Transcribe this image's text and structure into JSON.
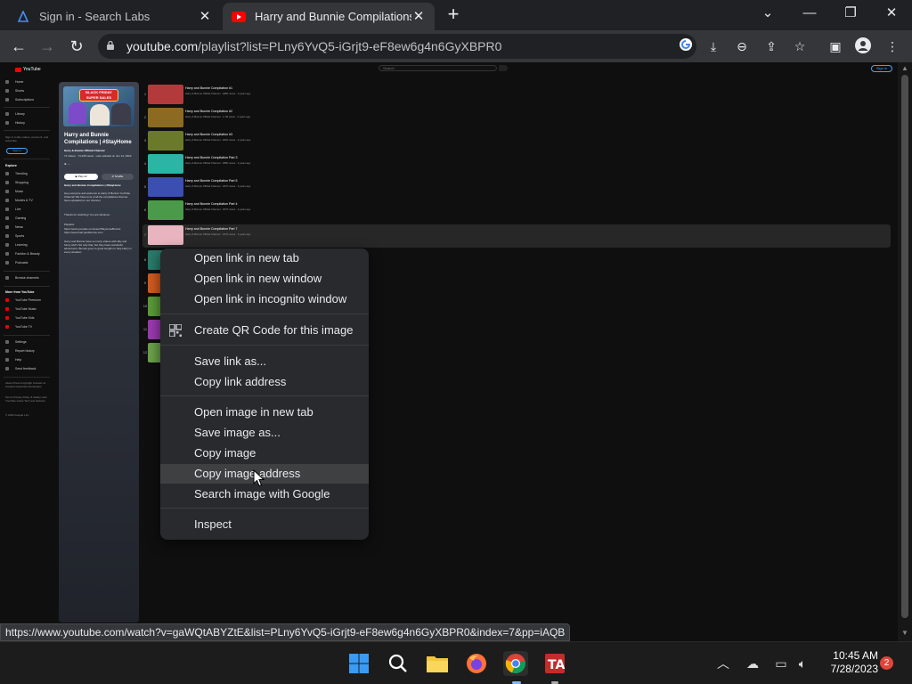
{
  "browser": {
    "tabs": [
      {
        "title": "Sign in - Search Labs",
        "icon": "search-labs-icon"
      },
      {
        "title": "Harry and Bunnie Compilations | ",
        "icon": "youtube-icon"
      }
    ],
    "url_host": "youtube.com",
    "url_path": "/playlist?list=PLny6YvQ5-iGrjt9-eF8ew6g4n6GyXBPR0",
    "status_url": "https://www.youtube.com/watch?v=gaWQtABYZtE&list=PLny6YvQ5-iGrjt9-eF8ew6g4n6GyXBPR0&index=7&pp=iAQB"
  },
  "youtube": {
    "logo": "YouTube",
    "search_placeholder": "Search",
    "sign_in": "Sign in",
    "guide": {
      "items_top": [
        "Home",
        "Shorts",
        "Subscriptions"
      ],
      "items_lib": [
        "Library",
        "History"
      ],
      "signin_prompt": "Sign in to like videos, comment, and subscribe.",
      "signin_btn": "Sign in",
      "explore_head": "Explore",
      "explore": [
        "Trending",
        "Shopping",
        "Music",
        "Movies & TV",
        "Live",
        "Gaming",
        "News",
        "Sports",
        "Learning",
        "Fashion & Beauty",
        "Podcasts"
      ],
      "browse": "Browse channels",
      "more_head": "More from YouTube",
      "more": [
        "YouTube Premium",
        "YouTube Music",
        "YouTube Kids",
        "YouTube TV"
      ],
      "settings": [
        "Settings",
        "Report history",
        "Help",
        "Send feedback"
      ],
      "footer1": "About Press Copyright Contact us Creators Advertise Developers",
      "footer2": "Terms Privacy Policy & Safety How YouTube works Test new features",
      "footer3": "© 2023 Google LLC"
    },
    "playlist": {
      "banner": "BLACK FRIDAY SUPER SALES",
      "title": "Harry and Bunnie Compilations | #StayHome",
      "channel": "Harry & Bunnie Official Channel",
      "meta": "74 videos · 74,468 views · Last updated on Jun 14, 2020",
      "play_all": "Play all",
      "shuffle": "Shuffle",
      "desc_title": "Harry and Bunnie Compilations | #StayHome",
      "desc": "Hey everyone and welcome to Harry & Bunnie YouTube Channel! We have tons of all the compilations that we have uploaded on our channel.",
      "desc2": "Thanks for watching! You are fabulous.",
      "desc3": "Playlists:",
      "desc4": "https://www.youtube.com/user/PlaysomeBunnie https://www.harryandbunnie.com",
      "desc5": "Harry and Bunnie have so many videos with silly and funny stuff. Not only that, but they have wonderful adventures. Bunnie goes to great lengths to help Harry in every situation."
    },
    "videos": [
      {
        "idx": "1",
        "title": "Harry and Bunnie Compilation #1",
        "meta": "Harry & Bunnie Official Channel · 488K views · 3 years ago",
        "color": "#b23a3a"
      },
      {
        "idx": "2",
        "title": "Harry and Bunnie Compilation #2",
        "meta": "Harry & Bunnie Official Channel · 1.7M views · 3 years ago",
        "color": "#8d6a22"
      },
      {
        "idx": "3",
        "title": "Harry and Bunnie Compilation #3",
        "meta": "Harry & Bunnie Official Channel · 362K views · 3 years ago",
        "color": "#6a7a2a"
      },
      {
        "idx": "4",
        "title": "Harry and Bunnie Compilation Part 3",
        "meta": "Harry & Bunnie Official Channel · 488K views · 3 years ago",
        "color": "#2bb5a5"
      },
      {
        "idx": "5",
        "title": "Harry and Bunnie Compilation Part 5",
        "meta": "Harry & Bunnie Official Channel · 187K views · 3 years ago",
        "color": "#3a4fb0"
      },
      {
        "idx": "6",
        "title": "Harry and Bunnie Compilation Part 4",
        "meta": "Harry & Bunnie Official Channel · 157K views · 3 years ago",
        "color": "#4a9a4a"
      },
      {
        "idx": "7",
        "title": "Harry and Bunnie Compilation Part 7",
        "meta": "Harry & Bunnie Official Channel · 157K views · 3 years ago",
        "color": "#e8b4c0"
      },
      {
        "idx": "8",
        "title": "",
        "meta": "",
        "color": "#2a7a6a"
      },
      {
        "idx": "9",
        "title": "",
        "meta": "",
        "color": "#d05a20"
      },
      {
        "idx": "10",
        "title": "",
        "meta": "",
        "color": "#5a9a3a"
      },
      {
        "idx": "11",
        "title": "",
        "meta": "",
        "color": "#9a3ab0"
      },
      {
        "idx": "12",
        "title": "",
        "meta": "",
        "color": "#6aa04a"
      }
    ]
  },
  "context_menu": {
    "items": [
      "Open link in new tab",
      "Open link in new window",
      "Open link in incognito window",
      "Create QR Code for this image",
      "Save link as...",
      "Copy link address",
      "Open image in new tab",
      "Save image as...",
      "Copy image",
      "Copy image address",
      "Search image with Google",
      "Inspect"
    ],
    "highlighted": "Copy image address"
  },
  "taskbar": {
    "time": "10:45 AM",
    "date": "7/28/2023",
    "notifications": "2",
    "apps": [
      "windows-start-icon",
      "search-icon",
      "file-explorer-icon",
      "firefox-icon",
      "chrome-icon",
      "app-icon"
    ]
  },
  "colors": {
    "accent_blue": "#3ea6ff",
    "youtube_red": "#ff0000",
    "menu_bg": "#292a2d",
    "highlight": "#3f4042"
  }
}
